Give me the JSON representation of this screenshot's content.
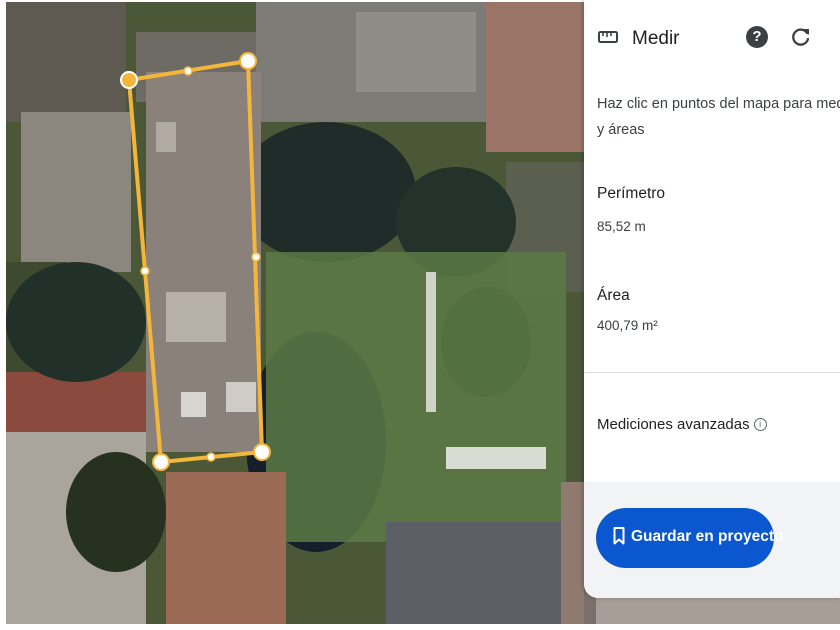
{
  "panel": {
    "title": "Medir",
    "title_icon": "ruler-icon",
    "help_label": "?",
    "help_icon": "help-icon",
    "reset_icon": "reset-icon",
    "description_line1": "Haz clic en puntos del mapa para medir d",
    "description_line2": "y áreas",
    "perimeter_label": "Perímetro",
    "perimeter_value": "85,52 m",
    "area_label": "Área",
    "area_value": "400,79 m²",
    "advanced_label": "Mediciones avanzadas",
    "info_icon": "info-icon",
    "info_glyph": "i",
    "save_label": "Guardar en proyecto",
    "save_icon": "bookmark-icon"
  },
  "map": {
    "type": "satellite",
    "measurement_polygon_color": "#f4b63a",
    "vertex_count": 4
  },
  "colors": {
    "accent": "#0b57d0",
    "panel_bg": "#ffffff",
    "footer_bg": "#f1f3f4",
    "text_primary": "#202124",
    "text_secondary": "#3c4043"
  }
}
